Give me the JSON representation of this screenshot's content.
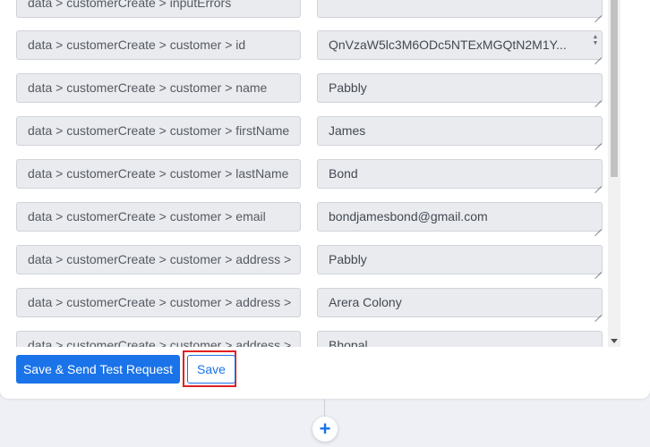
{
  "rows": [
    {
      "key": "data > customerCreate > inputErrors",
      "value": ""
    },
    {
      "key": "data > customerCreate > customer > id",
      "value": "QnVzaW5lc3M6ODc5NTExMGQtN2M1Y..."
    },
    {
      "key": "data > customerCreate > customer > name",
      "value": "Pabbly"
    },
    {
      "key": "data > customerCreate > customer > firstName",
      "value": "James"
    },
    {
      "key": "data > customerCreate > customer > lastName",
      "value": "Bond"
    },
    {
      "key": "data > customerCreate > customer > email",
      "value": "bondjamesbond@gmail.com"
    },
    {
      "key": "data > customerCreate > customer > address >",
      "value": "Pabbly"
    },
    {
      "key": "data > customerCreate > customer > address >",
      "value": "Arera Colony"
    },
    {
      "key": "data > customerCreate > customer > address >",
      "value": "Bhopal"
    }
  ],
  "buttons": {
    "save_send": "Save & Send Test Request",
    "save": "Save"
  },
  "add_step_icon": "+",
  "colors": {
    "primary": "#1a73e8",
    "highlight": "#e02020"
  }
}
